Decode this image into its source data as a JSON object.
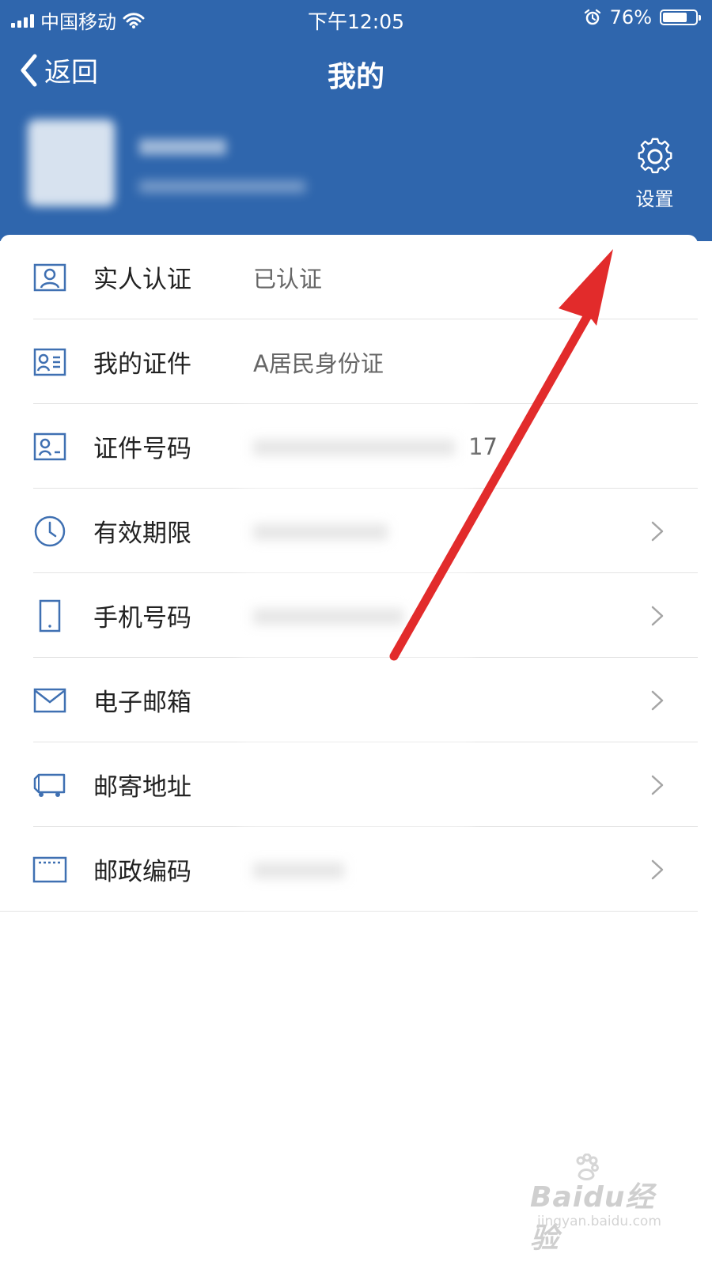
{
  "status_bar": {
    "carrier": "中国移动",
    "time": "下午12:05",
    "battery": "76%",
    "battery_level": 0.76
  },
  "nav": {
    "back_label": "返回",
    "title": "我的"
  },
  "profile": {
    "settings_label": "设置"
  },
  "list": {
    "items": [
      {
        "label": "实人认证",
        "value": "已认证",
        "icon": "id-badge-icon"
      },
      {
        "label": "我的证件",
        "value": "A居民身份证",
        "icon": "id-card-icon"
      },
      {
        "label": "证件号码",
        "value": "17",
        "icon": "id-number-icon"
      },
      {
        "label": "有效期限",
        "value": "",
        "icon": "clock-icon"
      },
      {
        "label": "手机号码",
        "value": "",
        "icon": "tablet-icon"
      },
      {
        "label": "电子邮箱",
        "value": "",
        "icon": "mail-icon"
      },
      {
        "label": "邮寄地址",
        "value": "",
        "icon": "truck-icon"
      },
      {
        "label": "邮政编码",
        "value": "",
        "icon": "postcode-icon"
      }
    ]
  },
  "watermark": {
    "brand": "Baidu经验",
    "url": "jingyan.baidu.com"
  },
  "colors": {
    "header_blue": "#2f66ad",
    "icon_blue": "#3f70b2",
    "annotation_red": "#e22b2b"
  }
}
